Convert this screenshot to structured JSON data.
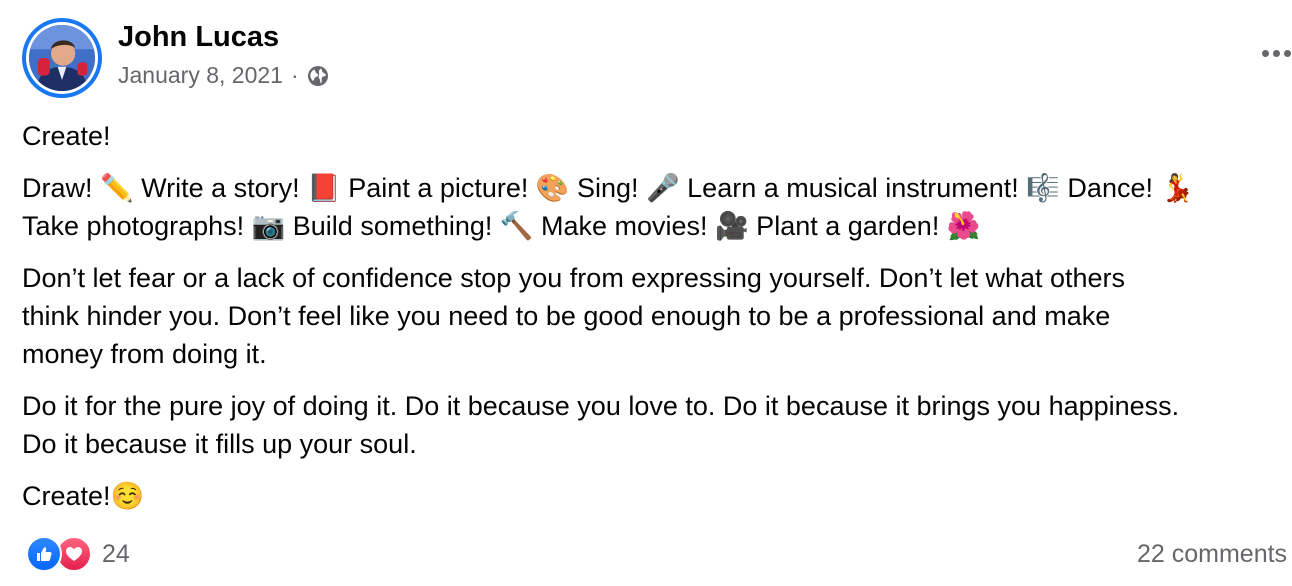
{
  "post": {
    "author": "John Lucas",
    "date": "January 8, 2021",
    "separator": "·",
    "audience_icon": "globe-icon",
    "more_icon": "more-options-icon",
    "paragraphs": [
      [
        "Create!"
      ],
      [
        "Draw! ✏️ Write a story! 📕 Paint a picture! 🎨 Sing! 🎤 Learn a musical instrument! 🎼 Dance! 💃",
        "Take photographs! 📷 Build something! 🔨 Make movies! 🎥 Plant a garden! 🌺"
      ],
      [
        "Don’t let fear or a lack of confidence stop you from expressing yourself. Don’t let what others",
        "think hinder you. Don’t feel like you need to be good enough to be a professional and make",
        "money from doing it."
      ],
      [
        "Do it for the pure joy of doing it. Do it because you love to. Do it because it brings you happiness.",
        "Do it because it fills up your soul."
      ],
      [
        "Create!☺️"
      ]
    ]
  },
  "footer": {
    "reaction_icons": [
      "like-icon",
      "love-icon"
    ],
    "reaction_count": "24",
    "comments": "22 comments"
  },
  "colors": {
    "accent": "#1877f2",
    "secondary_text": "#65676b",
    "primary_text": "#050505"
  }
}
